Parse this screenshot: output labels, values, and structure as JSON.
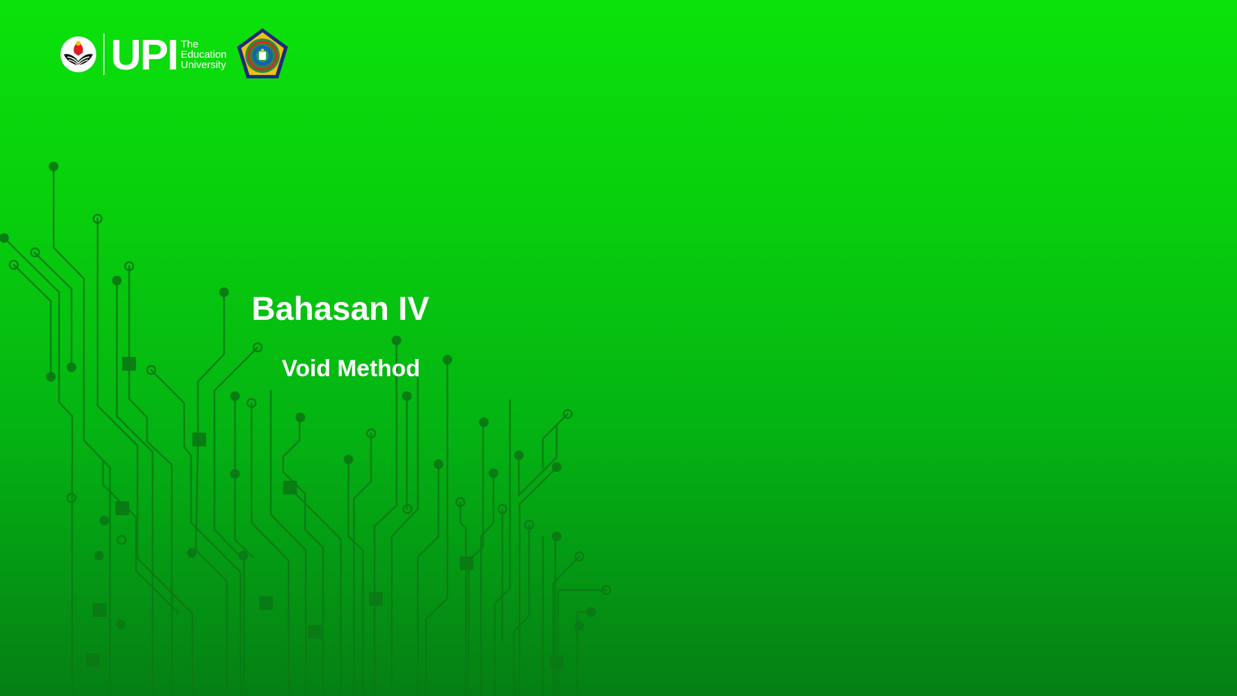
{
  "slide": {
    "title": "Bahasan IV",
    "subtitle": "Void Method"
  },
  "header": {
    "logo_wordmark": "UPI",
    "logo_tagline_line1": "The",
    "logo_tagline_line2": "Education",
    "logo_tagline_line3": "University"
  },
  "icons": {
    "upi_emblem": "upi-emblem-icon",
    "seal": "institution-seal-icon",
    "circuit": "circuit-board-decoration"
  },
  "colors": {
    "background_top": "#0be20b",
    "background_bottom": "#057f14",
    "circuit_line": "#0a7a14",
    "text": "#ffffff"
  }
}
